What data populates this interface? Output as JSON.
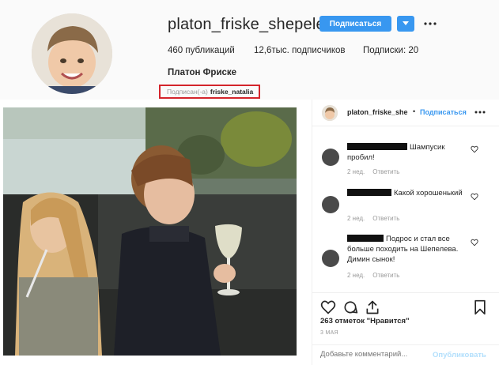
{
  "profile": {
    "username": "platon_friske_shepelev",
    "follow_label": "Подписаться",
    "dropdown_icon": "chevron-down-icon",
    "more_icon": "more-horizontal-icon",
    "stats": {
      "posts": "460 публикаций",
      "followers_count": "12,6тыс.",
      "followers_label": " подписчиков",
      "following": "Подписки: 20"
    },
    "full_name": "Платон Фриске",
    "followed_by_label": "Подписан(-а)",
    "followed_by_account": "friske_natalia"
  },
  "post": {
    "header": {
      "username": "platon_friske_she",
      "separator": "•",
      "follow_label": "Подписаться",
      "more_icon": "more-horizontal-icon"
    },
    "comments": [
      {
        "text": "Шампусик пробил!",
        "age": "2 нед.",
        "reply_label": "Ответить"
      },
      {
        "text": "Какой хорошенький",
        "age": "2 нед.",
        "reply_label": "Ответить"
      },
      {
        "text": "Подрос и стал все больше походить на Шепелева. Димин сынок!",
        "age": "2 нед.",
        "reply_label": "Ответить"
      }
    ],
    "likes": "263 отметок \"Нравится\"",
    "date": "3 МАЯ",
    "add_comment_placeholder": "Добавьте комментарий...",
    "publish_label": "Опубликовать"
  },
  "colors": {
    "accent": "#3897f0",
    "highlight_border": "#d4242b",
    "muted": "#999999"
  }
}
